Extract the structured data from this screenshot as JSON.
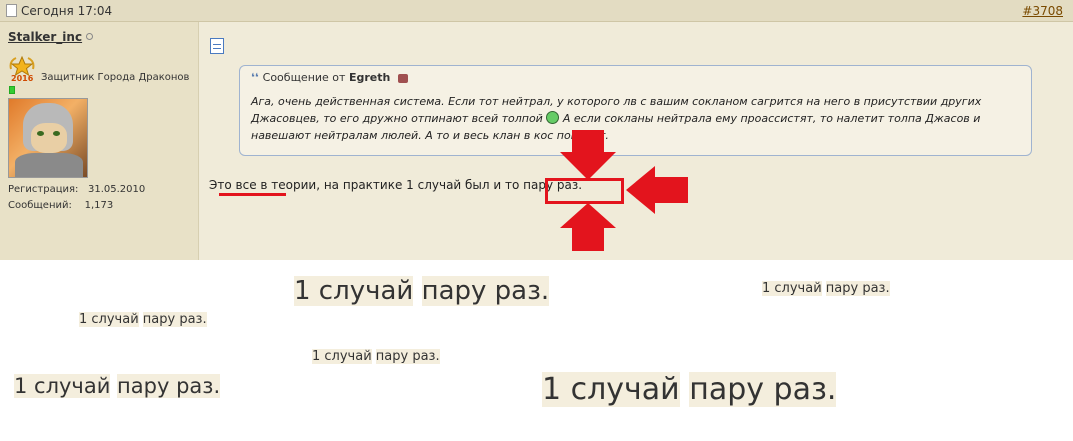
{
  "post": {
    "date": "Сегодня 17:04",
    "post_number": "#3708",
    "author": {
      "username": "Stalker_inc",
      "medal_year": "2016",
      "rank": "Защитник Города Драконов",
      "registration_label": "Регистрация:",
      "registration_value": "31.05.2010",
      "messages_label": "Сообщений:",
      "messages_value": "1,173"
    },
    "quote": {
      "prefix": "Сообщение от",
      "author": "Egreth",
      "text_part1": "Ага, очень действенная система. Если тот нейтрал, у которого лв с вашим сокланом сагрится на него в присутствии других Джасовцев, то его дружно отпинают всей толпой",
      "text_part2": " А если сокланы нейтрала ему проассистят, то налетит толпа Джасов и навешают нейтралам люлей. А то и весь клан в кос попадет."
    },
    "body": {
      "part1": "Это все в теории, на практике ",
      "highlight1": "1 случай",
      "part2": " был и то ",
      "highlight2": "пару раз."
    }
  },
  "samples": [
    {
      "a": "1 случай",
      "b": "пару раз."
    },
    {
      "a": "1 случай",
      "b": "пару раз."
    },
    {
      "a": "1 случай",
      "b": "пару раз."
    },
    {
      "a": "1 случай",
      "b": "пару раз."
    },
    {
      "a": "1 случай",
      "b": "пару раз."
    },
    {
      "a": "1 случай",
      "b": "пару раз."
    }
  ],
  "colors": {
    "highlight": "#e3141d",
    "post_background": "#f0ebd9",
    "sidebar_background": "#e8e1c7",
    "quote_border": "#9fb3d0"
  },
  "icons": [
    "document-icon",
    "medal-icon",
    "avatar",
    "quote-icon",
    "goto-post-icon",
    "smiley-icon",
    "arrow-down-icon",
    "arrow-up-icon",
    "arrow-left-icon"
  ]
}
